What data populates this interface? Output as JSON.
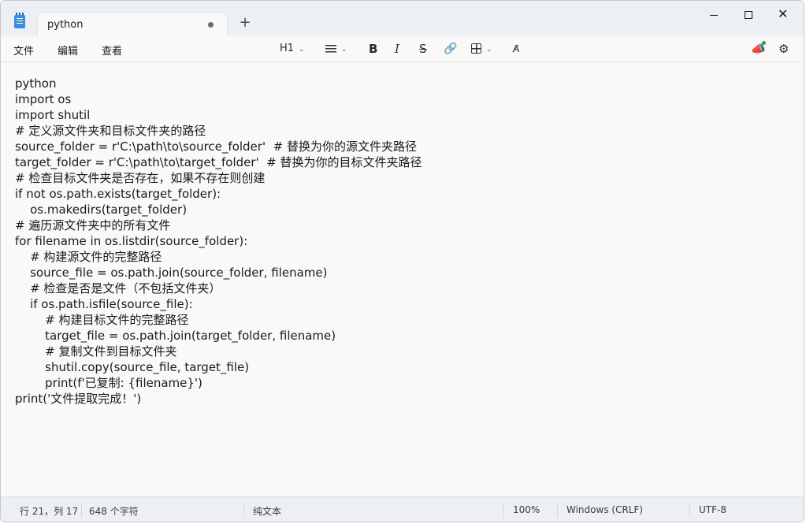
{
  "tab": {
    "title": "python"
  },
  "menu": {
    "file": "文件",
    "edit": "编辑",
    "view": "查看"
  },
  "toolbar": {
    "heading": "H1"
  },
  "editor": {
    "lines": [
      "python",
      "import os",
      "import shutil",
      "# 定义源文件夹和目标文件夹的路径",
      "source_folder = r'C:\\path\\to\\source_folder'  # 替换为你的源文件夹路径",
      "target_folder = r'C:\\path\\to\\target_folder'  # 替换为你的目标文件夹路径",
      "# 检查目标文件夹是否存在，如果不存在则创建",
      "if not os.path.exists(target_folder):",
      "    os.makedirs(target_folder)",
      "# 遍历源文件夹中的所有文件",
      "for filename in os.listdir(source_folder):",
      "    # 构建源文件的完整路径",
      "    source_file = os.path.join(source_folder, filename)",
      "    # 检查是否是文件（不包括文件夹）",
      "    if os.path.isfile(source_file):",
      "        # 构建目标文件的完整路径",
      "        target_file = os.path.join(target_folder, filename)",
      "        # 复制文件到目标文件夹",
      "        shutil.copy(source_file, target_file)",
      "        print(f'已复制: {filename}')",
      "print('文件提取完成！')"
    ]
  },
  "status": {
    "position": "行 21，列 17",
    "chars": "648 个字符",
    "type": "纯文本",
    "zoom": "100%",
    "eol": "Windows (CRLF)",
    "encoding": "UTF-8"
  },
  "colors": {
    "accent": "#3c8dde",
    "notify": "#2e9c5a"
  },
  "icons": [
    "notepad-icon",
    "close-tab-icon",
    "plus-icon",
    "minimize-icon",
    "maximize-icon",
    "close-icon",
    "list-icon",
    "bold-icon",
    "italic-icon",
    "strikethrough-icon",
    "link-icon",
    "table-icon",
    "spellcheck-icon",
    "megaphone-icon",
    "gear-icon"
  ]
}
